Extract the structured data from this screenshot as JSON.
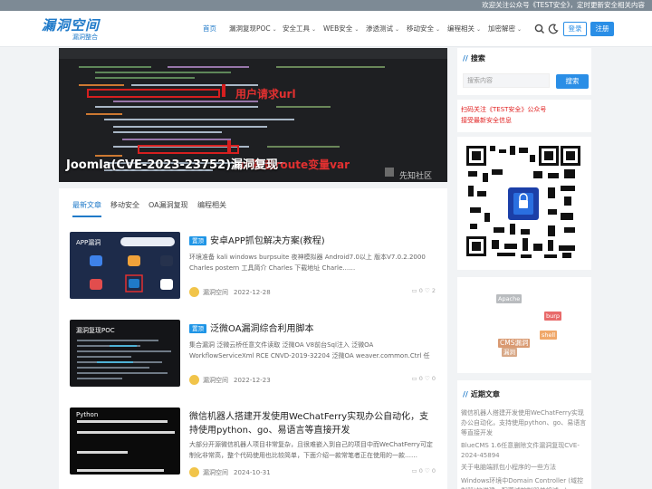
{
  "notice": {
    "text": "欢迎关注公众号《TEST安全》，定时更新安全相关内容"
  },
  "header": {
    "logo_main": "漏洞空间",
    "logo_sub": "漏洞整合",
    "nav": [
      {
        "label": "首页",
        "active": true,
        "dropdown": false
      },
      {
        "label": "漏洞复现POC",
        "active": false,
        "dropdown": true
      },
      {
        "label": "安全工具",
        "active": false,
        "dropdown": true
      },
      {
        "label": "WEB安全",
        "active": false,
        "dropdown": true
      },
      {
        "label": "渗透测试",
        "active": false,
        "dropdown": true
      },
      {
        "label": "移动安全",
        "active": false,
        "dropdown": true
      },
      {
        "label": "编程相关",
        "active": false,
        "dropdown": true
      },
      {
        "label": "加密解密",
        "active": false,
        "dropdown": true
      }
    ],
    "search_icon": "search-icon",
    "theme_icon": "moon-icon",
    "login_label": "登录",
    "register_label": "注册"
  },
  "hero": {
    "title": "Joomla(CVE-2023-23752)漏洞复现",
    "annotation_1": "用户请求url",
    "annotation_2": "url覆盖route变量var",
    "watermark": "先知社区"
  },
  "tabs": [
    "最新文章",
    "移动安全",
    "OA漏洞复现",
    "编程相关"
  ],
  "articles": [
    {
      "badge": "置顶",
      "title": "安卓APP抓包解决方案(教程)",
      "excerpt": "环境准备 kali windows burpsuite 夜神模拟器 Android7.0以上 版本V7.0.2.2000 Charles postern 工具简介 Charles 下载地址 Charle……",
      "author": "漏洞空间",
      "date": "2022-12-28",
      "comments": "0",
      "likes": "2",
      "thumb_label": "APP漏洞"
    },
    {
      "badge": "置顶",
      "title": "泛微OA漏洞综合利用脚本",
      "excerpt": "集合漏洞 泛微云桥任意文件读取 泛微OA V8前台Sql注入 泛微OA WorkflowServiceXml RCE CNVD-2019-32204 泛微OA weaver.common.Ctrl 任意文件上传 泛微O……",
      "author": "漏洞空间",
      "date": "2022-12-23",
      "comments": "0",
      "likes": "0",
      "thumb_label": "漏洞复现POC"
    },
    {
      "badge": "",
      "title": "微信机器人搭建开发使用WeChatFerry实现办公自动化，支持使用python、go、易语言等直接开发",
      "excerpt": "大部分开源微信机器人项目非常复杂，且很难嵌入到自己的项目中而WeChatFerry可定制化非常高，整个代码使用也比较简单，下面介绍一款常笔者正在使用的一款……",
      "author": "漏洞空间",
      "date": "2024-10-31",
      "comments": "0",
      "likes": "0",
      "thumb_label": "Python"
    }
  ],
  "sidebar": {
    "search_title": "搜索",
    "search_placeholder": "搜索内容",
    "search_button": "搜索",
    "promo_line1": "扫码关注《TEST安全》公众号",
    "promo_line2": "接受最新安全信息",
    "tags": [
      "Apache",
      "burp",
      "shell",
      "CMS漏洞",
      "漏洞"
    ],
    "recent_title": "近期文章",
    "recent": [
      "微信机器人搭建开发使用WeChatFerry实现办公自动化，支持使用python、go、易语言等直接开发",
      "BlueCMS 1.6任意删除文件漏洞复现CVE-2024-45894",
      "关于电脑端抓包小程序的一些方法",
      "Windows环境中Domain Controller (域控制器)的搭建，配置域控制器并将域...)"
    ]
  },
  "colors": {
    "accent": "#1f7ac9",
    "button": "#2a8ee6",
    "promo": "#e12222"
  }
}
